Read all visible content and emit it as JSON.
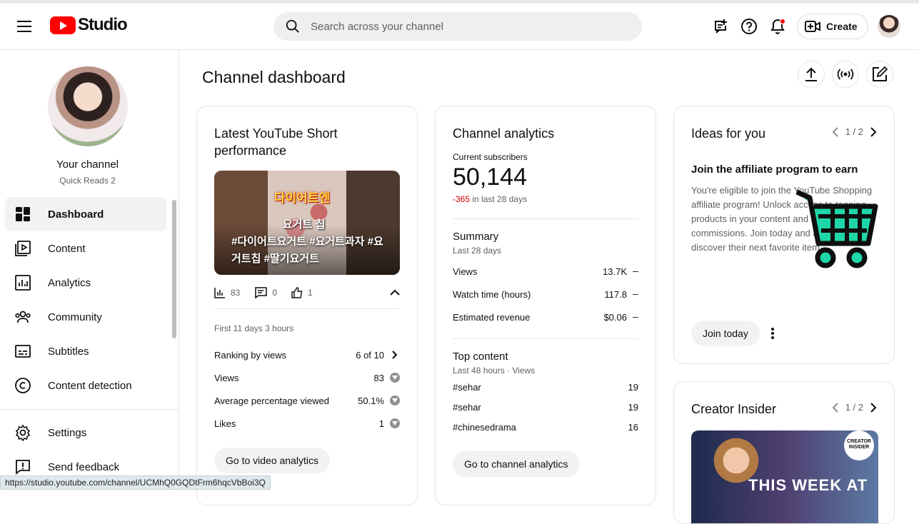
{
  "header": {
    "logo_text": "Studio",
    "search_placeholder": "Search across your channel",
    "create_label": "Create"
  },
  "sidebar": {
    "channel_title": "Your channel",
    "channel_name": "Quick Reads 2",
    "items": [
      {
        "label": "Dashboard",
        "icon": "dashboard-icon",
        "active": true
      },
      {
        "label": "Content",
        "icon": "content-icon"
      },
      {
        "label": "Analytics",
        "icon": "analytics-icon"
      },
      {
        "label": "Community",
        "icon": "community-icon"
      },
      {
        "label": "Subtitles",
        "icon": "subtitles-icon"
      },
      {
        "label": "Content detection",
        "icon": "copyright-icon"
      }
    ],
    "footer_items": [
      {
        "label": "Settings",
        "icon": "gear-icon"
      },
      {
        "label": "Send feedback",
        "icon": "feedback-icon"
      }
    ]
  },
  "main": {
    "title": "Channel dashboard"
  },
  "short_card": {
    "title": "Latest YouTube Short performance",
    "thumb_title": "다이어트엔",
    "thumb_sub": "요거트 칩",
    "thumb_caption": "#다이어트요거트 #요거트과자 #요거트칩 #딸기요거트",
    "views_count": "83",
    "comments_count": "0",
    "likes_count": "1",
    "period": "First 11 days 3 hours",
    "rows": [
      {
        "label": "Ranking by views",
        "value": "6 of 10"
      },
      {
        "label": "Views",
        "value": "83"
      },
      {
        "label": "Average percentage viewed",
        "value": "50.1%"
      },
      {
        "label": "Likes",
        "value": "1"
      }
    ],
    "button": "Go to video analytics"
  },
  "analytics_card": {
    "title": "Channel analytics",
    "subs_label": "Current subscribers",
    "subs_value": "50,144",
    "subs_change": "-365",
    "subs_change_suffix": " in last 28 days",
    "summary_title": "Summary",
    "summary_period": "Last 28 days",
    "summary_rows": [
      {
        "label": "Views",
        "value": "13.7K"
      },
      {
        "label": "Watch time (hours)",
        "value": "117.8"
      },
      {
        "label": "Estimated revenue",
        "value": "$0.06"
      }
    ],
    "top_title": "Top content",
    "top_period": "Last 48 hours · Views",
    "top_rows": [
      {
        "label": "#sehar",
        "value": "19"
      },
      {
        "label": "#sehar",
        "value": "19"
      },
      {
        "label": "#chinesedrama",
        "value": "16"
      }
    ],
    "button": "Go to channel analytics"
  },
  "ideas_card": {
    "title": "Ideas for you",
    "pager": "1 / 2",
    "heading": "Join the affiliate program to earn",
    "body": "You're eligible to join the YouTube Shopping affiliate program! Unlock access to tagging products in your content and earn commissions. Join today and help your fans discover their next favorite item.",
    "button": "Join today",
    "accent": "#1ed6a8"
  },
  "insider_card": {
    "title": "Creator Insider",
    "pager": "1 / 2",
    "badge": "CREATOR INSIDER",
    "thumb_text": "THIS WEEK AT"
  },
  "status_url": "https://studio.youtube.com/channel/UCMhQ0GQDtFrm6hqcVbBoi3Q"
}
